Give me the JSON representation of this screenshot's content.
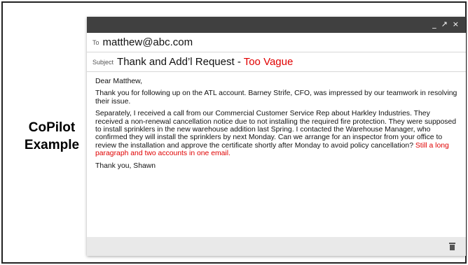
{
  "slide": {
    "side_label_line1": "CoPilot",
    "side_label_line2": "Example"
  },
  "window": {
    "controls": [
      "_",
      "↗",
      "×"
    ]
  },
  "email": {
    "to_label": "To",
    "to_value": "matthew@abc.com",
    "subject_label": "Subject",
    "subject_value": "Thank and Add’l Request - ",
    "subject_note": "Too Vague",
    "body": {
      "greeting": "Dear Matthew,",
      "para1": "Thank you for following up on the ATL account. Barney Strife, CFO, was impressed by our teamwork in resolving their issue.",
      "para2": "Separately, I received a call from our Commercial Customer Service Rep about Harkley Industries. They received a non-renewal cancellation notice due to not installing the required fire protection. They were supposed to install sprinklers in the new warehouse addition last Spring. I contacted the Warehouse Manager, who confirmed they will install the sprinklers by next Monday. Can we arrange for an inspector from your office to review the installation and approve the certificate shortly after Monday to avoid policy cancellation? ",
      "para2_note": "Still a long paragraph and two accounts in one email.",
      "signoff": "Thank you, Shawn"
    }
  },
  "colors": {
    "titlebar": "#404040",
    "warning": "#e00000",
    "bottombar": "#e9e9e9"
  },
  "icons": [
    "minimize-icon",
    "expand-icon",
    "close-icon",
    "trash-icon"
  ]
}
